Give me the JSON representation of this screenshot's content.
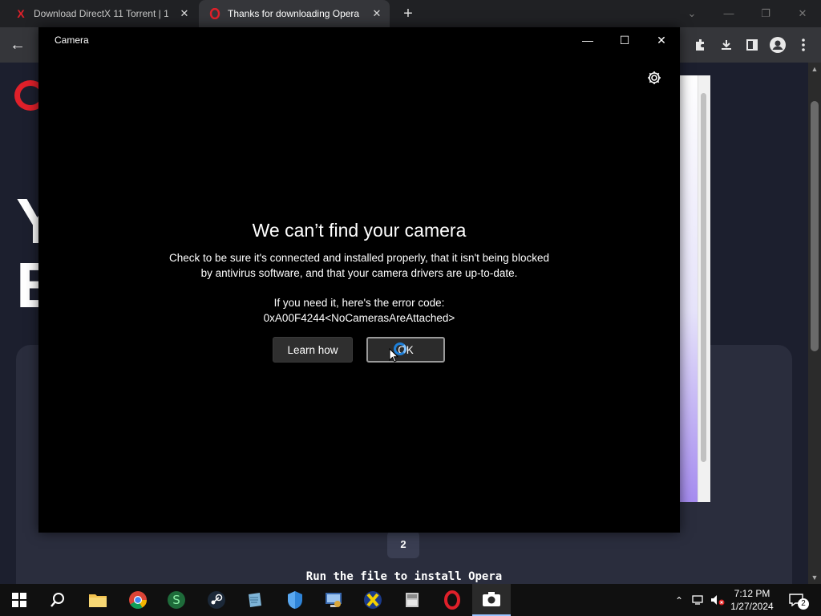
{
  "browser": {
    "tabs": [
      {
        "title": "Download DirectX 11 Torrent | 1",
        "favicon": "X",
        "active": false
      },
      {
        "title": "Thanks for downloading Opera",
        "favicon": "O",
        "active": true
      }
    ],
    "tab_close_glyph": "✕",
    "new_tab_glyph": "+",
    "back_glyph": "←"
  },
  "page": {
    "big_letter_1": "Y",
    "big_letter_2": "E",
    "step_number": "2",
    "run_text": "Run the file to install Opera"
  },
  "camera_window": {
    "title": "Camera",
    "heading": "We can’t find your camera",
    "body_line1": "Check to be sure it's connected and installed properly, that it isn't being blocked",
    "body_line2": "by antivirus software, and that your camera drivers are up-to-date.",
    "code_line1": "If you need it, here's the error code:",
    "code_line2": "0xA00F4244<NoCamerasAreAttached>",
    "learn_button": "Learn how",
    "ok_button": "OK"
  },
  "taskbar": {
    "time": "7:12 PM",
    "date": "1/27/2024",
    "notification_count": "2"
  },
  "colors": {
    "opera_red": "#e0202a",
    "page_bg": "#1c1f2e",
    "accent_blue": "#1e7fd8"
  }
}
